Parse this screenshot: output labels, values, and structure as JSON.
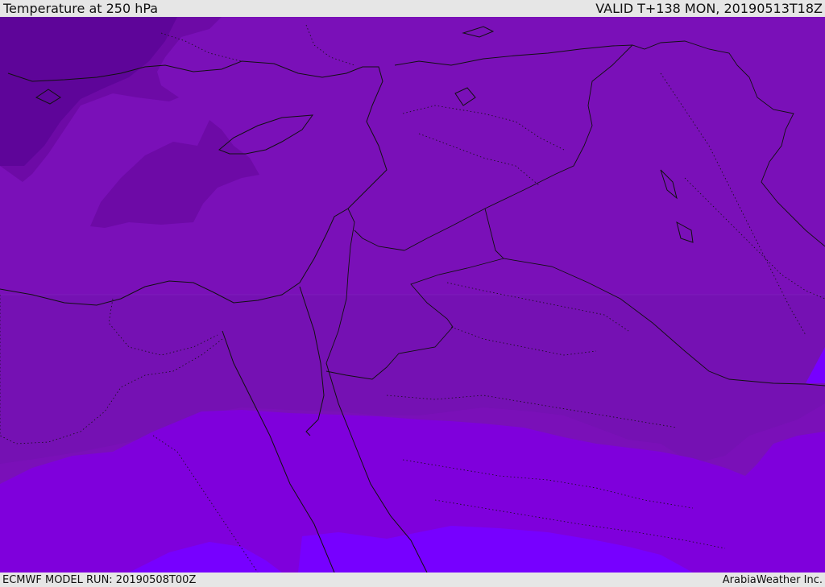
{
  "header": {
    "title": "Temperature at 250 hPa",
    "valid_time": "VALID T+138 MON, 20190513T18Z"
  },
  "footer": {
    "model_run": "ECMWF MODEL RUN: 20190508T00Z",
    "credit": "ArabiaWeather Inc."
  },
  "map": {
    "colors": {
      "deep_cold": "#5e0599",
      "cold": "#6d0aa6",
      "band_mid": "#7511b3",
      "band_upper": "#7a10b8",
      "warm": "#7f00dc",
      "warmest": "#7700ff",
      "coast": "#111111"
    },
    "icons": [
      "temperature-band-icon"
    ]
  }
}
